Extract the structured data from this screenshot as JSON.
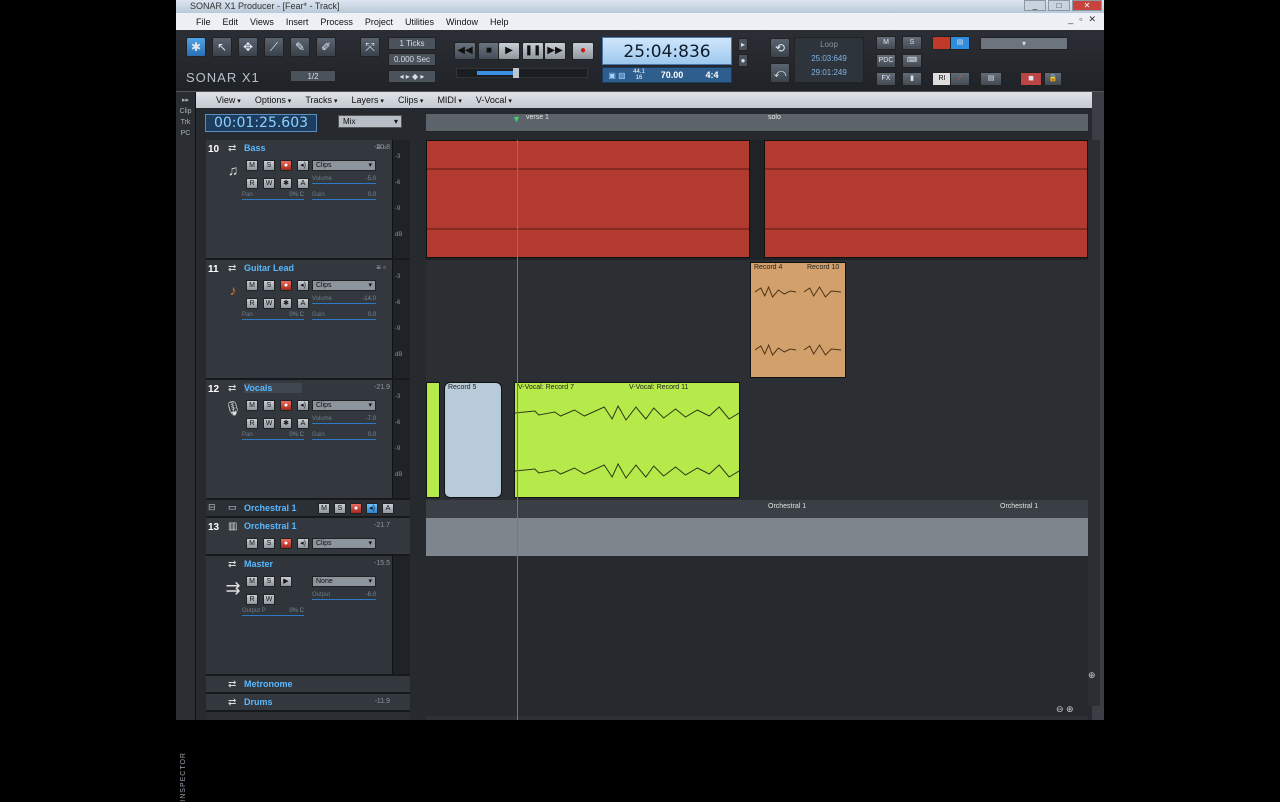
{
  "window": {
    "title": "SONAR X1 Producer - [Fear* - Track]",
    "min": "_",
    "max": "□",
    "close": "✕"
  },
  "menubar": [
    "File",
    "Edit",
    "Views",
    "Insert",
    "Process",
    "Project",
    "Utilities",
    "Window",
    "Help"
  ],
  "mdi": {
    "min": "_",
    "restore": "▫",
    "close": "✕"
  },
  "controlbar": {
    "logo": "SONAR X1",
    "snap_ticks": "1 Ticks",
    "snap_sec": "0.000 Sec",
    "ratio": "1/2",
    "time": "25:04:836",
    "tempo_small": "44.1\n16",
    "tempo": "70.00",
    "meter": "4:4",
    "loop_label": "Loop",
    "loop_start": "25:03:649",
    "loop_end": "29:01:249",
    "mix_m": "M",
    "mix_s": "S",
    "pdc": "PDC",
    "fx": "FX",
    "ri": "RI"
  },
  "leftstrip": [
    "Clip",
    "Trk",
    "PC"
  ],
  "inspector_label": "INSPECTOR",
  "trackview": {
    "menu": [
      "View",
      "Options",
      "Tracks",
      "Layers",
      "Clips",
      "MIDI",
      "V-Vocal"
    ],
    "now_time": "00:01:25.603",
    "mix_dropdown": "Mix",
    "ruler_markers": [
      "verse 1",
      "solo"
    ]
  },
  "tracks": [
    {
      "num": "10",
      "name": "Bass",
      "db": "-20.8",
      "dropdown": "Clips",
      "volume_label": "Volume",
      "volume": "-5.0",
      "pan_label": "Pan",
      "pan": "0% C",
      "gain_label": "Gain",
      "gain": "0.0"
    },
    {
      "num": "11",
      "name": "Guitar Lead",
      "db": "",
      "dropdown": "Clips",
      "volume_label": "Volume",
      "volume": "-14.0",
      "pan_label": "Pan",
      "pan": "0% C",
      "gain_label": "Gain",
      "gain": "0.0"
    },
    {
      "num": "12",
      "name": "Vocals",
      "db": "-21.9",
      "dropdown": "Clips",
      "volume_label": "Volume",
      "volume": "-7.0",
      "pan_label": "Pan",
      "pan": "0% C",
      "gain_label": "Gain",
      "gain": "0.0"
    }
  ],
  "folder": {
    "name": "Orchestral 1"
  },
  "track13": {
    "num": "13",
    "name": "Orchestral 1",
    "db": "-21.7",
    "dropdown": "Clips"
  },
  "master": {
    "name": "Master",
    "db": "-15.5",
    "dropdown": "None",
    "output_label": "Output",
    "output": "-6.0",
    "pan_label": "Output P",
    "pan": "0% C"
  },
  "bottom_tracks": [
    {
      "name": "Metronome"
    },
    {
      "name": "Drums",
      "db": "-11.9"
    }
  ],
  "clips": {
    "guitar": [
      "Record 4",
      "Record 10"
    ],
    "vocals": [
      "Record 5",
      "V-Vocal: Record 7",
      "V-Vocal: Record 11"
    ],
    "orch_folder": [
      "Orchestral 1",
      "Orchestral 1"
    ]
  },
  "meter_scale": [
    "-3",
    "-6",
    "-9",
    "dB"
  ],
  "colors": {
    "bass": "#b23a2e",
    "guitar": "#d2a06a",
    "vocal_green": "#b6ea4b",
    "vocal_blue": "#b7ccd8",
    "orch": "#7e858c"
  }
}
